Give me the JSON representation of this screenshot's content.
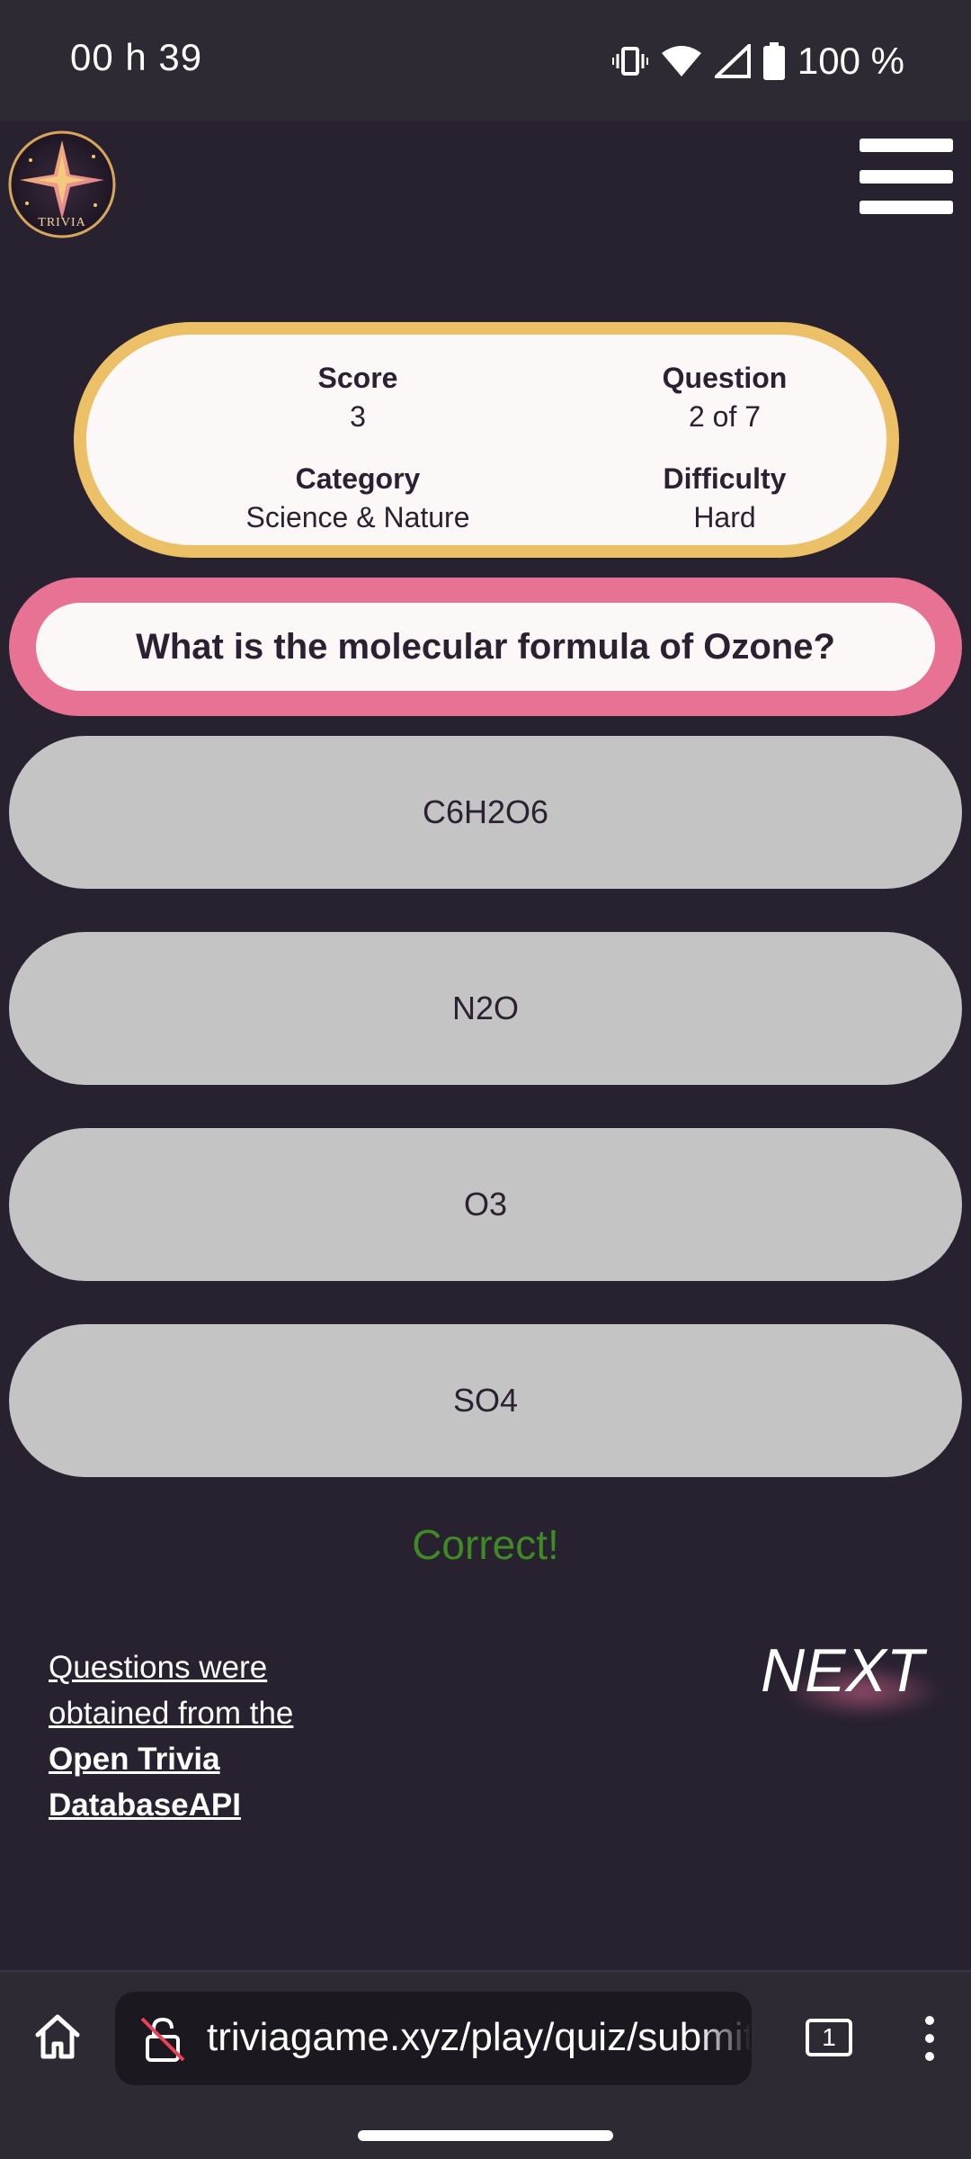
{
  "status_bar": {
    "time": "00 h 39",
    "battery_text": "100 %",
    "icons": [
      "vibrate-icon",
      "wifi-icon",
      "signal-icon",
      "battery-icon"
    ]
  },
  "header": {
    "logo_text": "TRIVIA",
    "menu_icon": "hamburger-menu-icon"
  },
  "info": {
    "score_label": "Score",
    "score_value": "3",
    "question_label": "Question",
    "question_value": "2 of 7",
    "category_label": "Category",
    "category_value": "Science & Nature",
    "difficulty_label": "Difficulty",
    "difficulty_value": "Hard"
  },
  "question": {
    "text": "What is the molecular formula of Ozone?"
  },
  "answers": [
    "C6H2O6",
    "N2O",
    "O3",
    "SO4"
  ],
  "result": {
    "text": "Correct!",
    "color": "#3f8a24"
  },
  "credits": {
    "line1": "Questions were",
    "line2": "obtained from the",
    "line3": "Open Trivia",
    "line4": "DatabaseAPI"
  },
  "next_label": "NEXT",
  "browser": {
    "url": "triviagame.xyz/play/quiz/submit",
    "tab_count": "1",
    "icons": [
      "home-icon",
      "insecure-lock-icon",
      "tabs-icon",
      "more-vert-icon"
    ]
  },
  "colors": {
    "background": "#272130",
    "card_border": "#ecc067",
    "question_border": "#e87293",
    "answer_bg": "#c4c4c4"
  }
}
